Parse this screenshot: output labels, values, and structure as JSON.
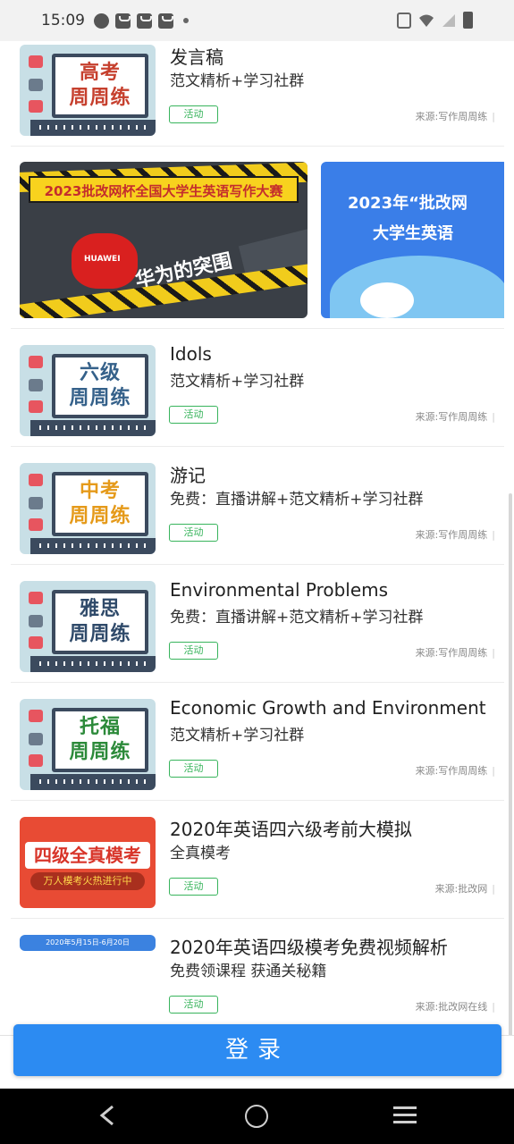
{
  "status_bar": {
    "time": "15:09"
  },
  "banner": {
    "left_title": "2023批改网杯全国大学生英语写作大赛",
    "left_subtitle": "华为的突围",
    "left_brand": "HUAWEI",
    "right_title_1": "2023年“批改网",
    "right_title_2": "大学生英语"
  },
  "items": [
    {
      "thumb_line1": "高考",
      "thumb_line2": "周周练",
      "title": "发言稿",
      "subtitle": "范文精析+学习社群",
      "tag": "活动",
      "source": "来源:写作周周练"
    },
    {
      "thumb_line1": "六级",
      "thumb_line2": "周周练",
      "title": "Idols",
      "subtitle": "范文精析+学习社群",
      "tag": "活动",
      "source": "来源:写作周周练"
    },
    {
      "thumb_line1": "中考",
      "thumb_line2": "周周练",
      "title": "游记",
      "subtitle": "免费：直播讲解+范文精析+学习社群",
      "tag": "活动",
      "source": "来源:写作周周练"
    },
    {
      "thumb_line1": "雅思",
      "thumb_line2": "周周练",
      "title": "Environmental Problems",
      "subtitle": "免费：直播讲解+范文精析+学习社群",
      "tag": "活动",
      "source": "来源:写作周周练"
    },
    {
      "thumb_line1": "托福",
      "thumb_line2": "周周练",
      "title": "Economic Growth and Environment",
      "subtitle": "范文精析+学习社群",
      "tag": "活动",
      "source": "来源:写作周周练"
    },
    {
      "thumb_line1": "四级全真模考",
      "thumb_line2": "万人模考火热进行中",
      "title": "2020年英语四六级考前大模拟",
      "subtitle": "全真模考",
      "tag": "活动",
      "source": "来源:批改网"
    },
    {
      "thumb_line1": "2020年5月15日-6月20日",
      "title": "2020年英语四级模考免费视频解析",
      "subtitle": "免费领课程 获通关秘籍",
      "tag": "活动",
      "source": "来源:批改网在线"
    }
  ],
  "login": {
    "label": "登录"
  },
  "colors": {
    "accent": "#2c8bf2",
    "tag_green": "#38b45c"
  }
}
